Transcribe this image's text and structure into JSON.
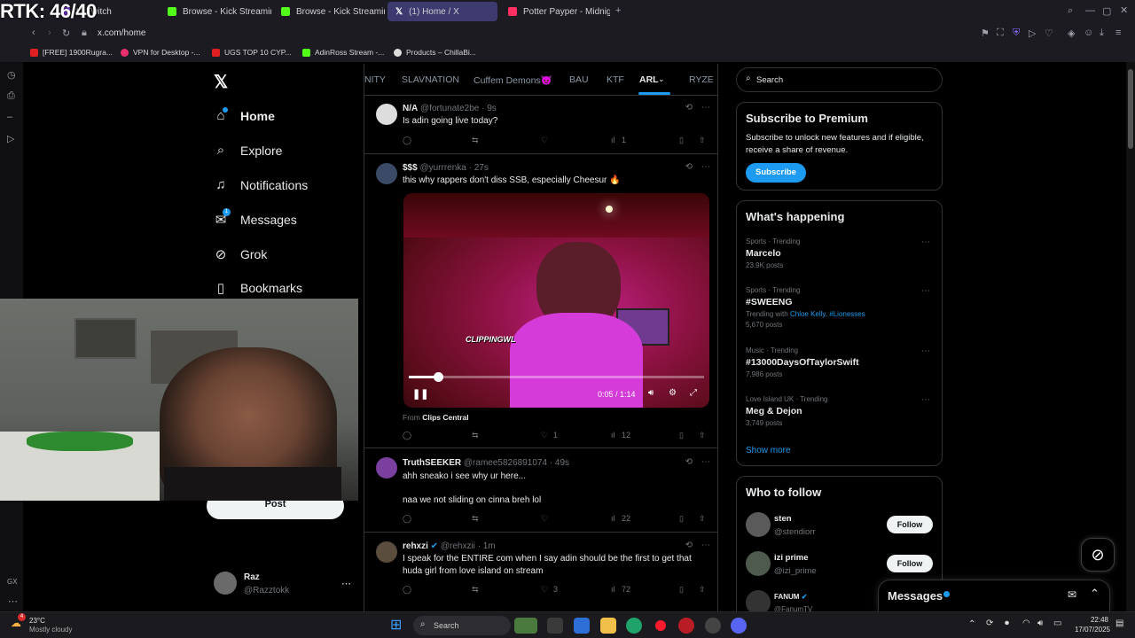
{
  "overlay": {
    "counter": "RTK: 46/40"
  },
  "browser": {
    "tabs": [
      {
        "label": "t · Twitch",
        "color": "#9146ff"
      },
      {
        "label": "Browse - Kick Streaming",
        "color": "#53fc18"
      },
      {
        "label": "Browse - Kick Streaming",
        "color": "#53fc18"
      },
      {
        "label": "(1) Home / X",
        "color": "#ffffff"
      },
      {
        "label": "Potter Payper - Midnight",
        "color": "#ff2e63"
      }
    ],
    "url": "x.com/home",
    "bookmarks": [
      "[FREE] 1900Rugra...",
      "VPN for Desktop -...",
      "UGS TOP 10 CYP...",
      "AdinRoss Stream -...",
      "Products – ChillaBi..."
    ]
  },
  "nav": {
    "home": "Home",
    "explore": "Explore",
    "notifications": "Notifications",
    "messages": "Messages",
    "messages_badge": "1",
    "grok": "Grok",
    "bookmarks": "Bookmarks",
    "post": "Post",
    "account_name": "Raz",
    "account_handle": "@Razztokk"
  },
  "lists": [
    "NITY",
    "SLAVNATION",
    "Cuffem Demons😈",
    "BAU",
    "KTF",
    "ARL",
    "RYZE"
  ],
  "posts": [
    {
      "name": "N/A",
      "handle": "@fortunate2be",
      "time": "· 9s",
      "text": "Is adin going live today?",
      "replies": "",
      "likes": "",
      "views": "1"
    },
    {
      "name": "$$$",
      "handle": "@yurrrenka",
      "time": "· 27s",
      "text": "this why rappers don't diss SSB, especially Cheesur 🔥",
      "video_time": "0:05 / 1:14",
      "video_caption": "CLIPPINGWL",
      "progress": 0.1,
      "from_prefix": "From",
      "from_source": "Clips Central",
      "likes": "1",
      "views": "12"
    },
    {
      "name": "TruthSEEKER",
      "handle": "@ramee5826891074",
      "time": "· 49s",
      "text": "ahh sneako i see why ur here...",
      "text2": "naa we not sliding on cinna breh lol",
      "likes": "",
      "views": "22"
    },
    {
      "name": "rehxzi",
      "handle": "@rehxzii",
      "time": "· 1m",
      "text": "I speak for the ENTIRE com when I say adin should be the first to get that",
      "text2": "huda girl from love island on stream",
      "likes": "3",
      "views": "72"
    }
  ],
  "search": {
    "placeholder": "Search"
  },
  "premium": {
    "title": "Subscribe to Premium",
    "text1": "Subscribe to unlock new features and if eligible,",
    "text2": "receive a share of revenue.",
    "button": "Subscribe"
  },
  "happening": {
    "title": "What's happening",
    "trends": [
      {
        "meta": "Sports · Trending",
        "name": "Marcelo",
        "extra": "",
        "count": "23.9K posts"
      },
      {
        "meta": "Sports · Trending",
        "name": "#SWEENG",
        "extra": "Trending with",
        "links": "Chloe Kelly, #Lionesses",
        "count": "5,670 posts"
      },
      {
        "meta": "Music · Trending",
        "name": "#13000DaysOfTaylorSwift",
        "extra": "",
        "count": "7,986 posts"
      },
      {
        "meta": "Love Island UK · Trending",
        "name": "Meg & Dejon",
        "extra": "",
        "count": "3,749 posts"
      }
    ],
    "show_more": "Show more"
  },
  "follow": {
    "title": "Who to follow",
    "users": [
      {
        "name": "sten",
        "handle": "@stendiorr",
        "button": "Follow"
      },
      {
        "name": "izi prime",
        "handle": "@izi_prime",
        "button": "Follow"
      },
      {
        "name": "FANUM",
        "handle": "@FanumTV"
      }
    ]
  },
  "messages_drawer": {
    "title": "Messages"
  },
  "taskbar": {
    "weather_temp": "23°C",
    "weather_desc": "Mostly cloudy",
    "search": "Search",
    "notif_badge": "4",
    "time": "22:48",
    "date": "17/07/2025"
  },
  "colors": {
    "accent": "#1d9bf0",
    "background": "#000000",
    "border": "#2f3336",
    "muted": "#71767b"
  }
}
